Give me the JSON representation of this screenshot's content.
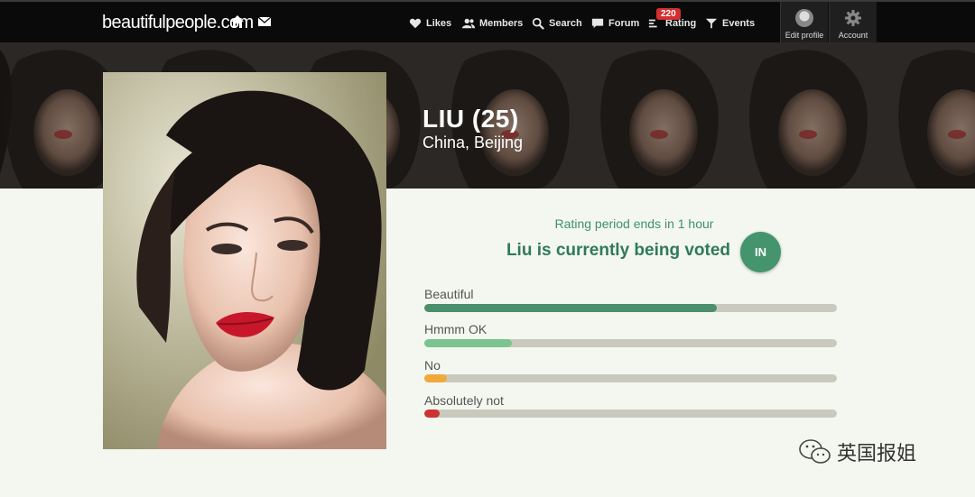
{
  "nav": {
    "logo_prefix": "beautiful",
    "logo_suffix": "people.com",
    "items": [
      {
        "label": "Likes",
        "icon": "heart-icon"
      },
      {
        "label": "Members",
        "icon": "members-icon"
      },
      {
        "label": "Search",
        "icon": "search-icon"
      },
      {
        "label": "Forum",
        "icon": "forum-icon"
      },
      {
        "label": "Rating",
        "icon": "rating-icon",
        "badge": "220"
      },
      {
        "label": "Events",
        "icon": "events-icon"
      }
    ],
    "edit_profile": "Edit profile",
    "account": "Account"
  },
  "profile": {
    "name": "LIU (25)",
    "location": "China, Beijing"
  },
  "rating": {
    "period_text": "Rating period ends in 1 hour",
    "status_text": "Liu is currently being voted",
    "in_label": "IN",
    "bars": [
      {
        "label": "Beautiful",
        "fraction": 0.709,
        "color": "#4b8f6c"
      },
      {
        "label": "Hmmm OK",
        "fraction": 0.212,
        "color": "#7bc48f"
      },
      {
        "label": "No",
        "fraction": 0.055,
        "color": "#f0a93a"
      },
      {
        "label": "Absolutely not",
        "fraction": 0.038,
        "color": "#cc3333"
      }
    ]
  },
  "watermark": {
    "text": "英国报姐"
  }
}
